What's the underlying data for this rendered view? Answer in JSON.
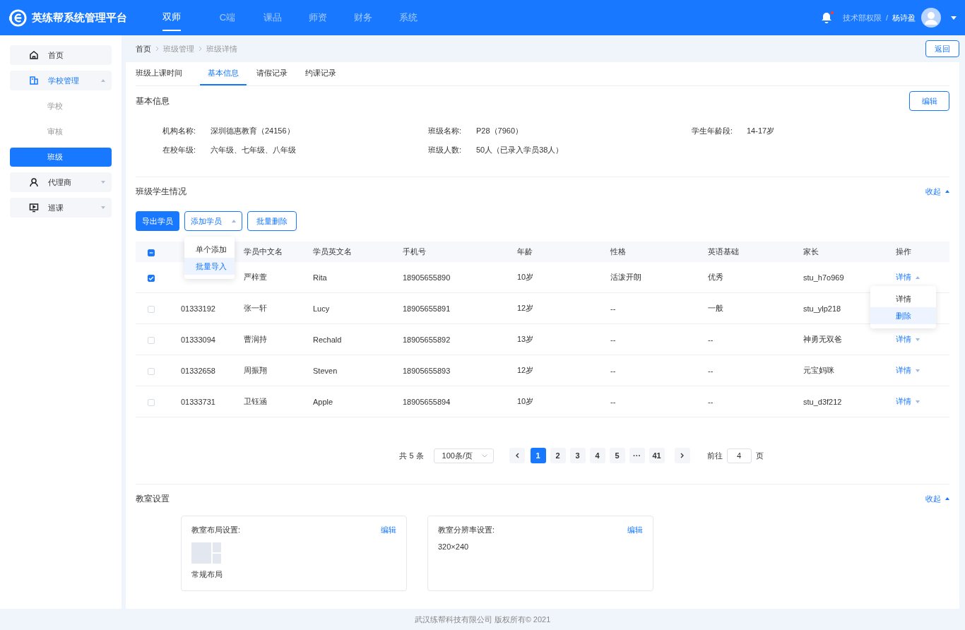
{
  "header": {
    "logo_text": "英练帮系统管理平台",
    "nav": [
      {
        "label": "双师",
        "selected": true
      },
      {
        "label": "C端",
        "selected": false
      },
      {
        "label": "课品",
        "selected": false
      },
      {
        "label": "师资",
        "selected": false
      },
      {
        "label": "财务",
        "selected": false
      },
      {
        "label": "系统",
        "selected": false
      }
    ],
    "notifications": {
      "unread": true
    },
    "role": "技术部权限",
    "separator": "/",
    "user": "杨诗盈"
  },
  "sidebar": {
    "items": [
      {
        "label": "首页",
        "selected": false
      },
      {
        "label": "学校管理",
        "selected": true,
        "expanded": true,
        "children": [
          {
            "label": "学校",
            "selected": false
          },
          {
            "label": "审核",
            "selected": false
          },
          {
            "label": "班级",
            "selected": true
          }
        ]
      },
      {
        "label": "代理商",
        "selected": false,
        "expanded": false
      },
      {
        "label": "巡课",
        "selected": false,
        "expanded": false
      }
    ]
  },
  "breadcrumb": [
    "首页",
    "班级管理",
    "班级详情"
  ],
  "back_button": "返回",
  "tabs": [
    {
      "label": "班级上课时间",
      "selected": false
    },
    {
      "label": "基本信息",
      "selected": true
    },
    {
      "label": "请假记录",
      "selected": false
    },
    {
      "label": "约课记录",
      "selected": false
    }
  ],
  "basic_info": {
    "title": "基本信息",
    "edit_button": "编辑",
    "fields": [
      {
        "label": "机构名称:",
        "value": "深圳德惠教育（24156）"
      },
      {
        "label": "班级名称:",
        "value": "P28（7960）"
      },
      {
        "label": "学生年龄段:",
        "value": "14-17岁"
      },
      {
        "label": "在校年级:",
        "value": "六年级、七年级、八年级"
      },
      {
        "label": "班级人数:",
        "value": "50人（已录入学员38人）"
      }
    ]
  },
  "students": {
    "title": "班级学生情况",
    "collapse": "收起",
    "expanded": true,
    "export_button": "导出学员",
    "add_button": {
      "label": "添加学员",
      "expanded": true,
      "menu": [
        {
          "label": "单个添加",
          "selected": false
        },
        {
          "label": "批量导入",
          "selected": true
        }
      ]
    },
    "batch_delete_button": "批量删除",
    "table": {
      "header_checkbox": {
        "indeterminate": true
      },
      "columns": [
        "学员中文名",
        "学员英文名",
        "手机号",
        "年龄",
        "性格",
        "英语基础",
        "家长",
        "操作"
      ],
      "rows": [
        {
          "checked": true,
          "name_cn": "严梓萱",
          "name_en": "Rita",
          "phone": "18905655890",
          "age": "10岁",
          "personality": "活泼开朗",
          "english": "优秀",
          "parent": "stu_h7o969",
          "action": "详情",
          "expanded": true
        },
        {
          "checked": false,
          "id": "01333192",
          "name_cn": "张一轩",
          "name_en": "Lucy",
          "phone": "18905655891",
          "age": "12岁",
          "personality": "--",
          "english": "一般",
          "parent": "stu_ylp218"
        },
        {
          "checked": false,
          "id": "01333094",
          "name_cn": "曹润持",
          "name_en": "Rechald",
          "phone": "18905655892",
          "age": "13岁",
          "personality": "--",
          "english": "--",
          "parent": "神勇无双爸",
          "action": "详情",
          "expanded": false
        },
        {
          "checked": false,
          "id": "01332658",
          "name_cn": "周振翔",
          "name_en": "Steven",
          "phone": "18905655893",
          "age": "12岁",
          "personality": "--",
          "english": "--",
          "parent": "元宝妈咪",
          "action": "详情",
          "expanded": false
        },
        {
          "checked": false,
          "id": "01333731",
          "name_cn": "卫钰涵",
          "name_en": "Apple",
          "phone": "18905655894",
          "age": "10岁",
          "personality": "--",
          "english": "--",
          "parent": "stu_d3f212",
          "action": "详情",
          "expanded": false
        }
      ],
      "action_menu": [
        {
          "label": "详情",
          "selected": false
        },
        {
          "label": "删除",
          "selected": true
        }
      ]
    },
    "pagination": {
      "total": "共 5 条",
      "page_size": "100条/页",
      "pages": [
        {
          "label": "1",
          "selected": true
        },
        {
          "label": "2",
          "selected": false
        },
        {
          "label": "3",
          "selected": false
        },
        {
          "label": "4",
          "selected": false
        },
        {
          "label": "5",
          "selected": false
        },
        {
          "label": "···",
          "selected": false
        },
        {
          "label": "41",
          "selected": false
        }
      ],
      "goto_label": "前往",
      "goto_value": "4",
      "goto_suffix": "页"
    }
  },
  "classroom": {
    "title": "教室设置",
    "collapse": "收起",
    "expanded": true,
    "cards": [
      {
        "kind": "layout",
        "title": "教室布局设置:",
        "edit": "编辑",
        "caption": "常规布局"
      },
      {
        "kind": "text",
        "title": "教室分辨率设置:",
        "edit": "编辑",
        "value": "320×240"
      }
    ]
  },
  "footer": "武汉练帮科技有限公司 版权所有© 2021"
}
